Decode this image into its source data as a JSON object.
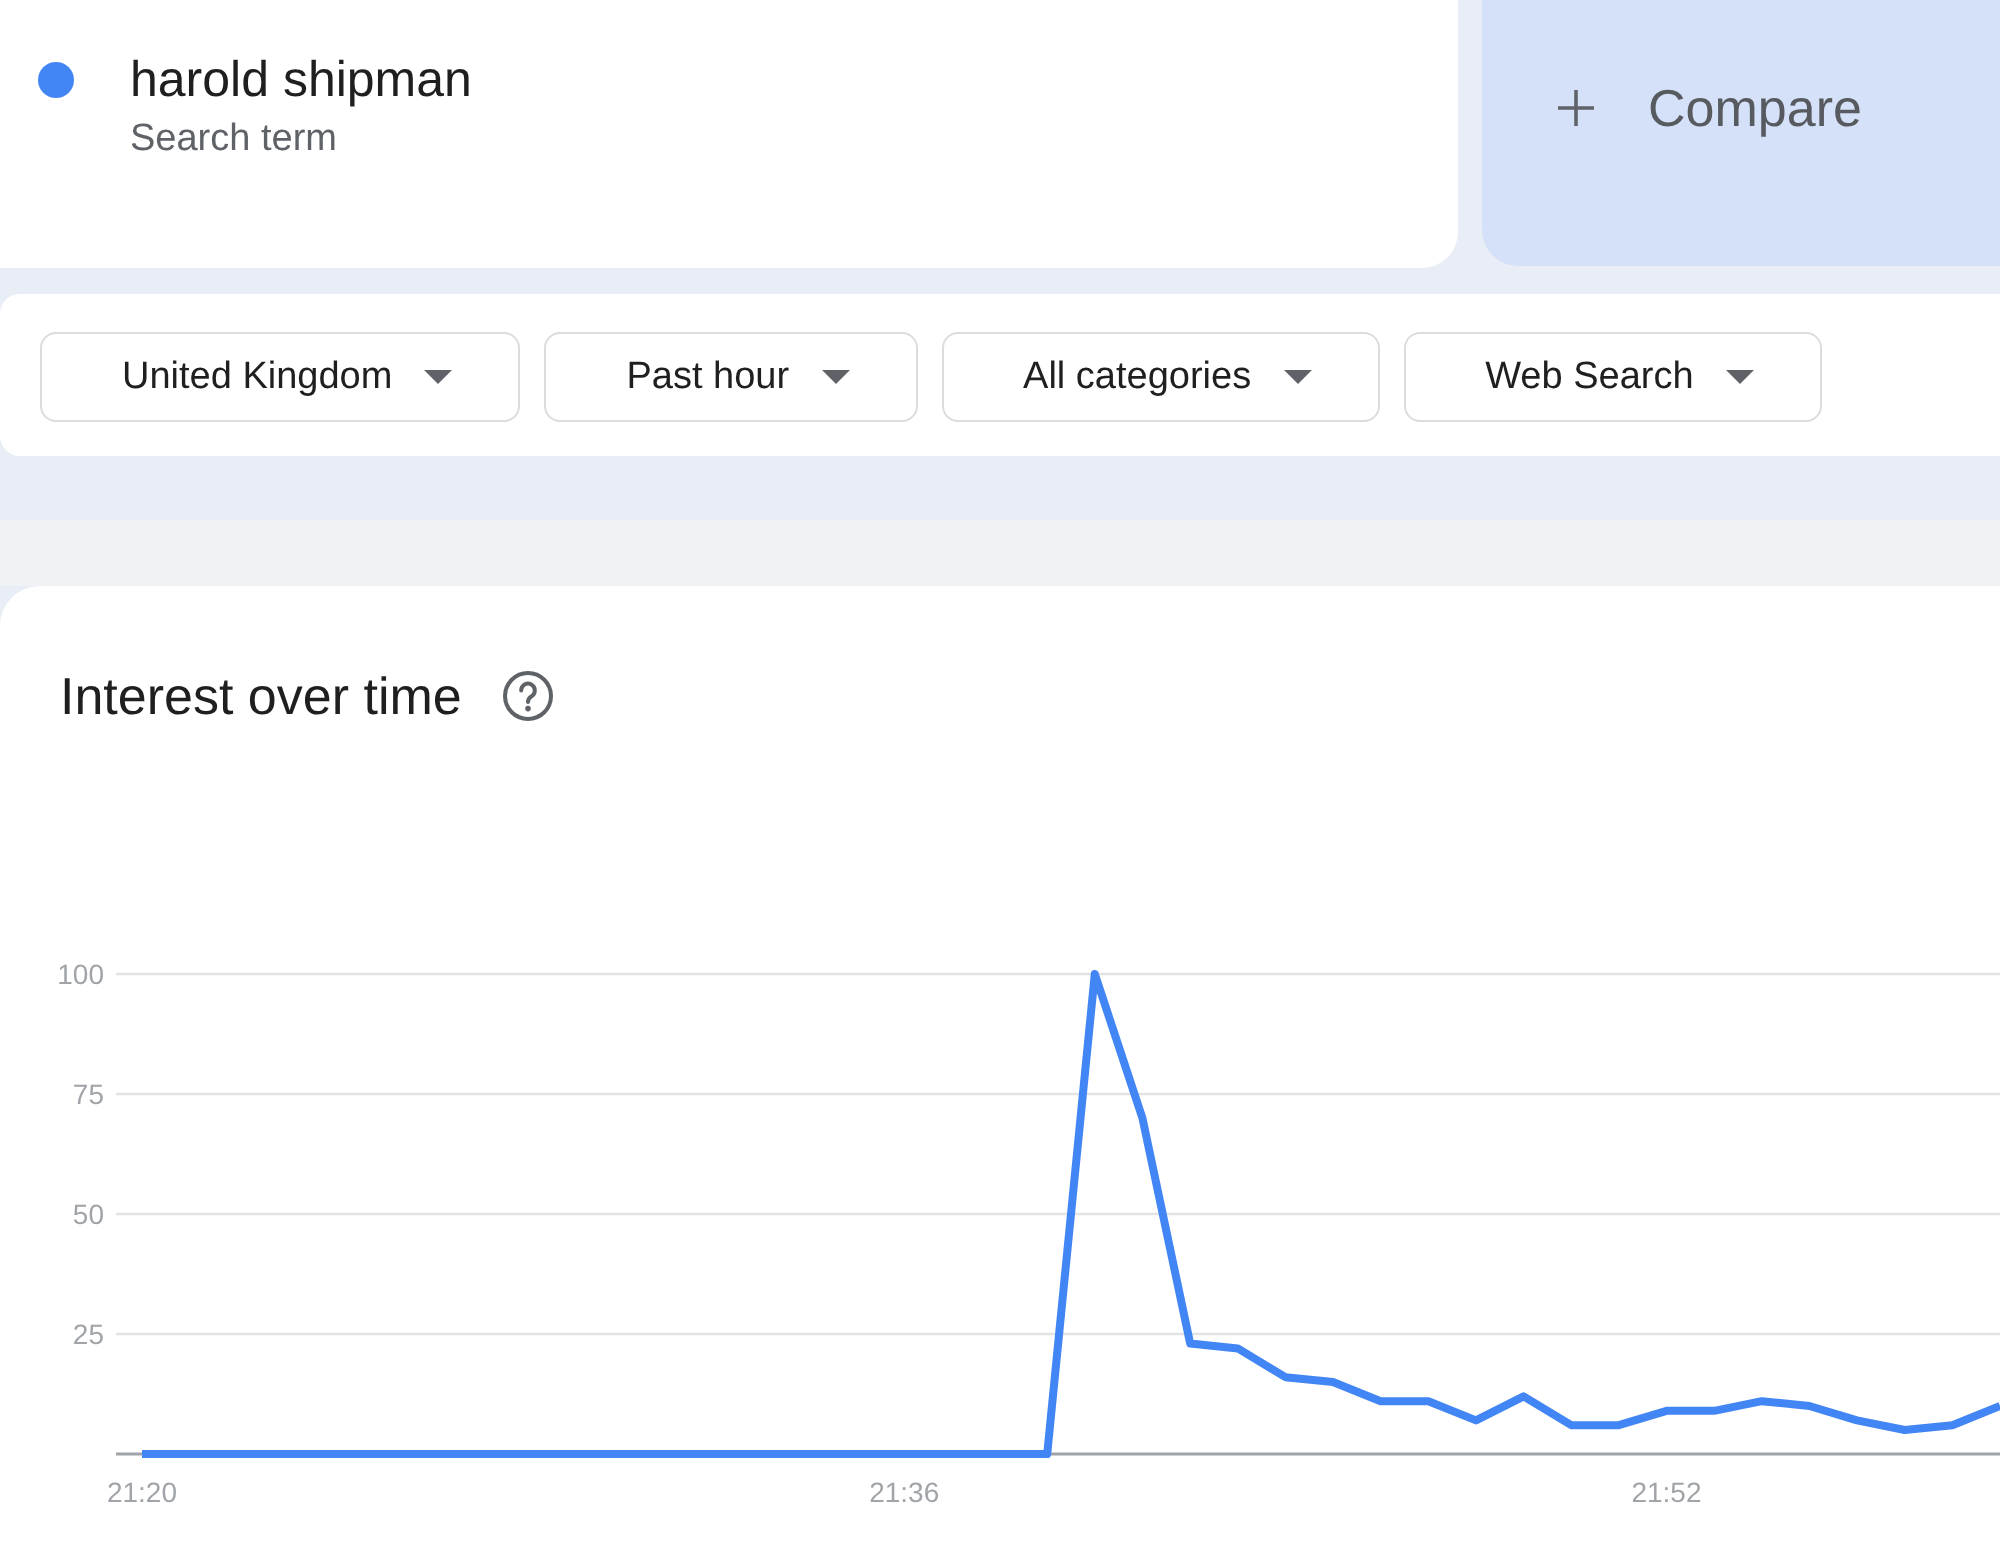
{
  "search_term": {
    "label": "harold shipman",
    "caption": "Search term",
    "color": "#4285f4"
  },
  "compare": {
    "label": "Compare"
  },
  "filters": [
    {
      "label": "United Kingdom"
    },
    {
      "label": "Past hour"
    },
    {
      "label": "All categories"
    },
    {
      "label": "Web Search"
    }
  ],
  "interest_over_time": {
    "title": "Interest over time",
    "chart_data": {
      "type": "line",
      "categories": [
        "21:20",
        null,
        null,
        null,
        null,
        null,
        null,
        null,
        null,
        null,
        null,
        null,
        null,
        null,
        null,
        null,
        "21:36",
        null,
        null,
        null,
        null,
        null,
        null,
        null,
        null,
        null,
        null,
        null,
        null,
        null,
        null,
        null,
        "21:52",
        null,
        null,
        null,
        null,
        null,
        null,
        null
      ],
      "series": [
        {
          "color": "#4285f4",
          "values": [
            0,
            0,
            0,
            0,
            0,
            0,
            0,
            0,
            0,
            0,
            0,
            0,
            0,
            0,
            0,
            0,
            0,
            0,
            0,
            0,
            100,
            70,
            23,
            22,
            16,
            15,
            11,
            11,
            7,
            12,
            6,
            6,
            9,
            9,
            11,
            10,
            7,
            5,
            6,
            10
          ]
        }
      ],
      "ylim": [
        0,
        100
      ],
      "yticks": [
        25,
        50,
        75,
        100
      ],
      "grid": true
    }
  }
}
